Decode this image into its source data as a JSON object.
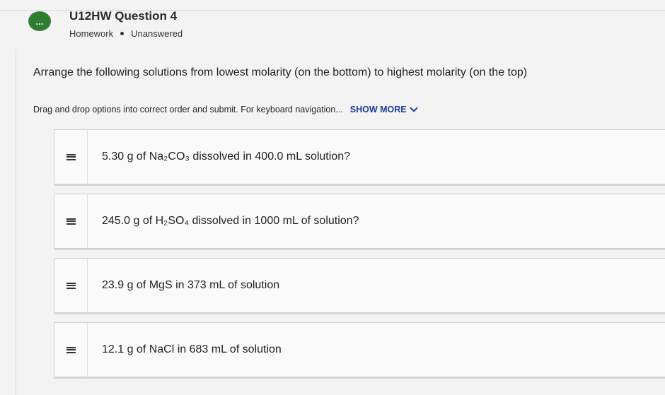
{
  "header": {
    "bubble_glyph": "...",
    "title": "U12HW Question 4",
    "type": "Homework",
    "status": "Unanswered"
  },
  "prompt": "Arrange the following solutions from lowest molarity (on the bottom) to highest molarity (on the top)",
  "instructions": "Drag and drop options into correct order and submit. For keyboard navigation...",
  "show_more_label": "SHOW MORE",
  "options": [
    {
      "label": "5.30 g of Na₂CO₃ dissolved in 400.0 mL solution?"
    },
    {
      "label": "245.0 g of H₂SO₄ dissolved in 1000 mL of solution?"
    },
    {
      "label": "23.9 g of MgS in 373 mL of solution"
    },
    {
      "label": "12.1 g of NaCl in 683 mL of solution"
    }
  ],
  "colors": {
    "bubble": "#2e7d32",
    "link": "#1a3c9a"
  }
}
